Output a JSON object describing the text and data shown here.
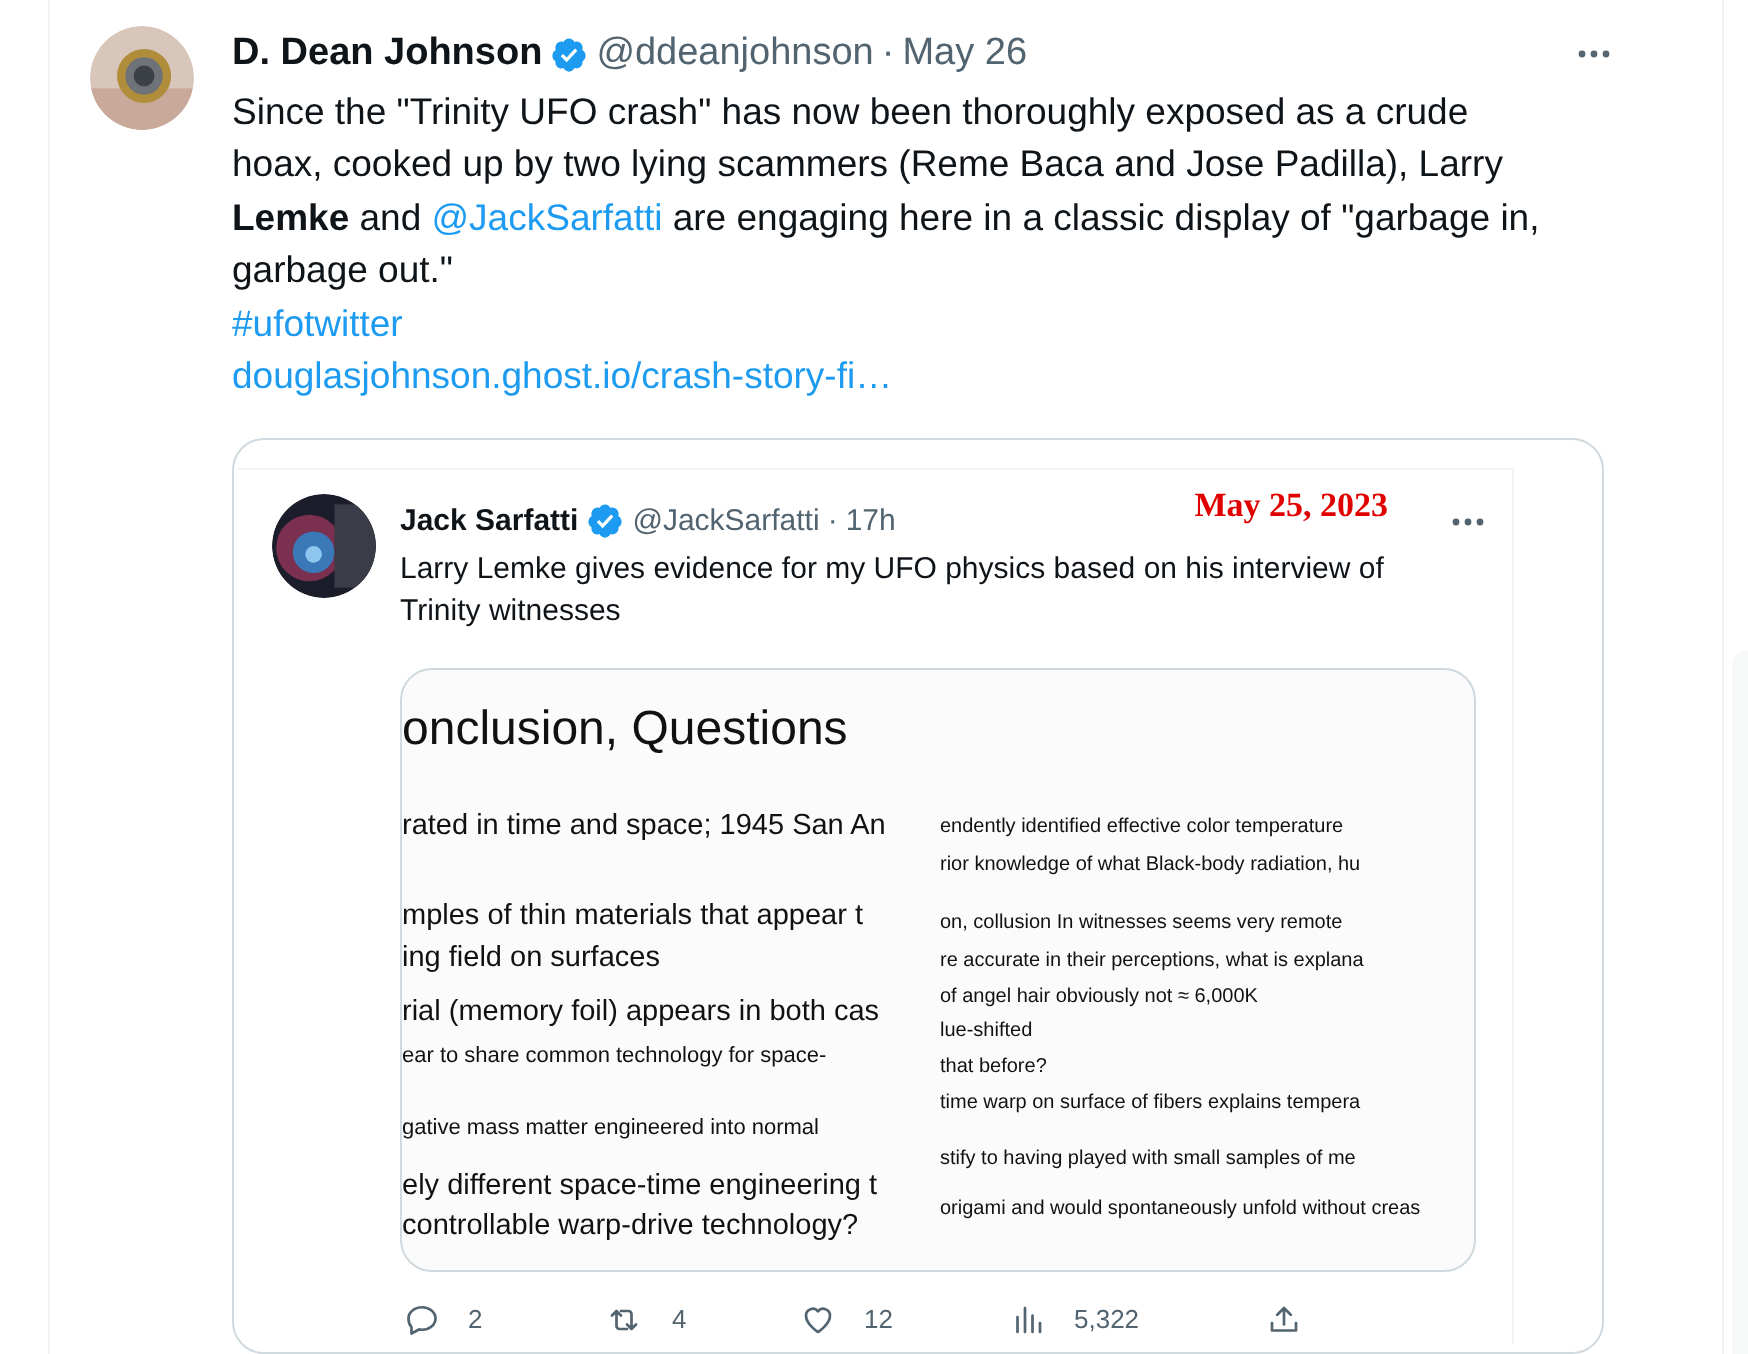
{
  "tweet": {
    "author": {
      "name": "D. Dean Johnson",
      "verified": true,
      "handle": "@ddeanjohnson",
      "separator": "·",
      "time": "May 26"
    },
    "body": [
      {
        "kind": "text",
        "text": "Since the \"Trinity UFO crash\" has now been thoroughly exposed as a crude hoax, cooked up by two lying scammers (Reme Baca and Jose Padilla), Larry "
      },
      {
        "kind": "bold",
        "text": "Lemke"
      },
      {
        "kind": "text",
        "text": " and "
      },
      {
        "kind": "mention",
        "text": "@JackSarfatti"
      },
      {
        "kind": "text",
        "text": " are engaging here in a classic display of \"garbage in, garbage out.\""
      }
    ],
    "hashtag": "#ufotwitter",
    "link": "douglasjohnson.ghost.io/crash-story-fi…",
    "annotation": "May 25, 2023",
    "quoted": {
      "author": {
        "name": "Jack Sarfatti",
        "verified": true,
        "handle": "@JackSarfatti",
        "separator": "·",
        "time": "17h"
      },
      "text": "Larry Lemke gives evidence for my UFO physics based on his interview of Trinity witnesses",
      "slide": {
        "title": "onclusion, Questions",
        "left": [
          {
            "kind": "large",
            "text": "rated in time and space; 1945 San An"
          },
          {
            "kind": "large",
            "text": "mples of thin materials that appear t"
          },
          {
            "kind": "large",
            "text": "ing field on surfaces"
          },
          {
            "kind": "large",
            "text": "rial (memory foil) appears in both cas"
          },
          {
            "kind": "small",
            "text": "ear to share common technology for space-"
          },
          {
            "kind": "small",
            "text": "gative mass matter engineered into normal"
          },
          {
            "kind": "large",
            "text": "ely different space-time engineering t"
          },
          {
            "kind": "large",
            "text": "controllable warp-drive technology?"
          }
        ],
        "right": [
          {
            "kind": "small",
            "text": "endently identified effective color temperature"
          },
          {
            "kind": "small",
            "text": "rior knowledge of what Black-body radiation, hu"
          },
          {
            "kind": "small",
            "text": "on, collusion In witnesses seems very remote"
          },
          {
            "kind": "small",
            "text": "re accurate in their perceptions, what is explana"
          },
          {
            "kind": "small",
            "text": "of angel hair obviously not ≈ 6,000K"
          },
          {
            "kind": "small",
            "text": "lue-shifted"
          },
          {
            "kind": "small",
            "text": "that before?"
          },
          {
            "kind": "small",
            "text": "time warp on surface of fibers explains tempera"
          },
          {
            "kind": "small",
            "text": "stify to having played with small samples of me"
          },
          {
            "kind": "small",
            "text": "origami and would spontaneously unfold without creas"
          }
        ]
      },
      "actions": [
        {
          "kind": "reply",
          "count": "2"
        },
        {
          "kind": "retweet",
          "count": "4"
        },
        {
          "kind": "like",
          "count": "12"
        },
        {
          "kind": "views",
          "count": "5,322"
        },
        {
          "kind": "share"
        }
      ]
    }
  }
}
